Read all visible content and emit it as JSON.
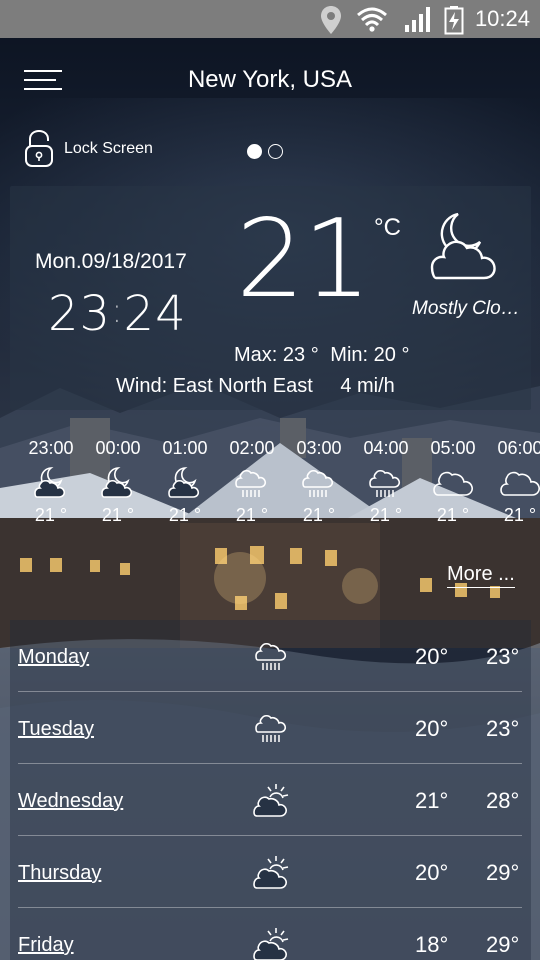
{
  "status_bar": {
    "time": "10:24",
    "icons": [
      "location-icon",
      "wifi-icon",
      "signal-icon",
      "battery-charging-icon"
    ]
  },
  "header": {
    "location": "New York, USA",
    "lock_screen_label": "Lock Screen",
    "page_count": 2,
    "active_page": 1
  },
  "current": {
    "date": "Mon.09/18/2017",
    "clock_hours": "23",
    "clock_minutes": "24",
    "temperature": "21",
    "unit": "°C",
    "condition": "Mostly Cloudy",
    "condition_icon": "moon-cloud-icon",
    "max_label": "Max:",
    "max_value": "23 °",
    "min_label": "Min:",
    "min_value": "20 °",
    "wind_label": "Wind:",
    "wind_direction": "East North East",
    "wind_speed": "4 mi/h"
  },
  "hourly": [
    {
      "time": "23:00",
      "icon": "moon-cloud-icon",
      "temp": "21 °"
    },
    {
      "time": "00:00",
      "icon": "moon-cloud-icon",
      "temp": "21 °"
    },
    {
      "time": "01:00",
      "icon": "moon-cloud-icon",
      "temp": "21 °"
    },
    {
      "time": "02:00",
      "icon": "rain-cloud-icon",
      "temp": "21 °"
    },
    {
      "time": "03:00",
      "icon": "rain-cloud-icon",
      "temp": "21 °"
    },
    {
      "time": "04:00",
      "icon": "rain-cloud-icon",
      "temp": "21 °"
    },
    {
      "time": "05:00",
      "icon": "cloud-icon",
      "temp": "21 °"
    },
    {
      "time": "06:00",
      "icon": "cloud-icon",
      "temp": "21 °"
    }
  ],
  "more_label": "More ...",
  "daily": [
    {
      "day": "Monday",
      "icon": "rain-cloud-icon",
      "low": "20°",
      "high": "23°"
    },
    {
      "day": "Tuesday",
      "icon": "rain-cloud-icon",
      "low": "20°",
      "high": "23°"
    },
    {
      "day": "Wednesday",
      "icon": "sun-cloud-icon",
      "low": "21°",
      "high": "28°"
    },
    {
      "day": "Thursday",
      "icon": "sun-cloud-icon",
      "low": "20°",
      "high": "29°"
    },
    {
      "day": "Friday",
      "icon": "sun-cloud-icon",
      "low": "18°",
      "high": "29°"
    }
  ]
}
